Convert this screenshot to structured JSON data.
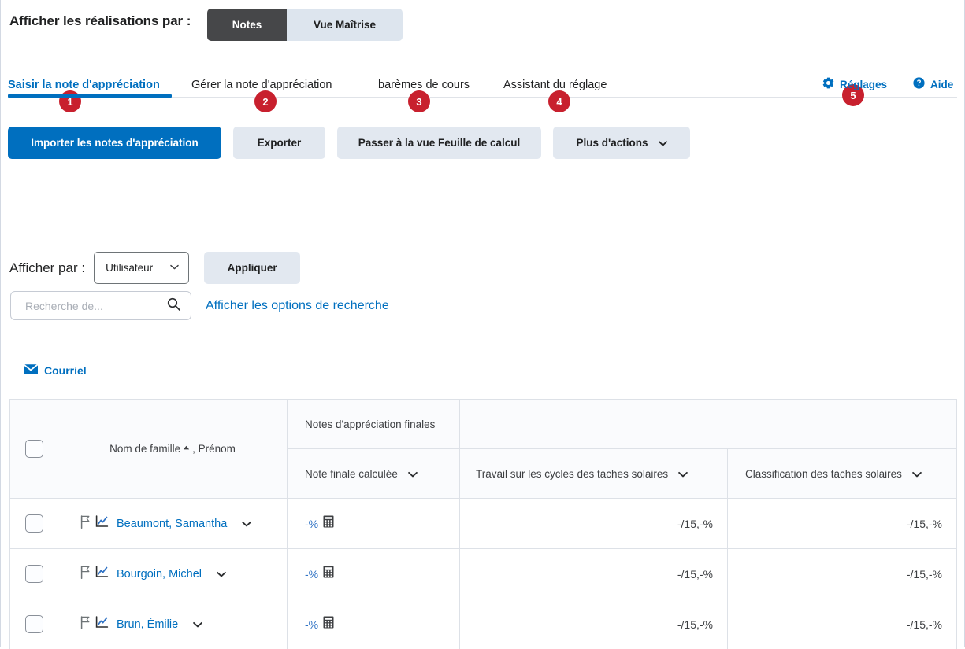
{
  "topbar": {
    "label": "Afficher les réalisations par :",
    "segments": [
      {
        "label": "Notes",
        "active": true
      },
      {
        "label": "Vue Maîtrise",
        "active": false
      }
    ]
  },
  "tabs": [
    {
      "badge": "1",
      "label": "Saisir la note d'appréciation",
      "active": true
    },
    {
      "badge": "2",
      "label": "Gérer la note d'appréciation",
      "active": false
    },
    {
      "badge": "3",
      "label": "barèmes de cours",
      "active": false
    },
    {
      "badge": "4",
      "label": "Assistant du réglage",
      "active": false
    }
  ],
  "topright": {
    "settings_badge": "5",
    "settings_label": "Réglages",
    "help_label": "Aide"
  },
  "actions": {
    "import_label": "Importer les notes d'appréciation",
    "export_label": "Exporter",
    "spreadsheet_label": "Passer à la vue Feuille de calcul",
    "more_label": "Plus d'actions"
  },
  "filter": {
    "label": "Afficher par :",
    "select_value": "Utilisateur",
    "apply_label": "Appliquer"
  },
  "search": {
    "placeholder": "Recherche de...",
    "value": "",
    "options_link": "Afficher les options de recherche"
  },
  "email": {
    "label": "Courriel"
  },
  "table": {
    "group_header": "Notes d'appréciation finales",
    "name_header": "Nom de famille",
    "name_header_suffix": ", Prénom",
    "columns": [
      {
        "label": "Note finale calculée"
      },
      {
        "label": "Travail sur les cycles des taches solaires"
      },
      {
        "label": "Classification des taches solaires"
      }
    ],
    "rows": [
      {
        "name": "Beaumont, Samantha",
        "final": "-%",
        "travail": "-/15,-%",
        "classification": "-/15,-%"
      },
      {
        "name": "Bourgoin, Michel",
        "final": "-%",
        "travail": "-/15,-%",
        "classification": "-/15,-%"
      },
      {
        "name": "Brun, Émilie",
        "final": "-%",
        "travail": "-/15,-%",
        "classification": "-/15,-%"
      }
    ]
  },
  "colors": {
    "accent": "#006fbf",
    "badge": "#c8202e",
    "segment_active_bg": "#464749",
    "segment_inactive_bg": "#dde5ee",
    "button_secondary_bg": "#e2e8f0"
  }
}
